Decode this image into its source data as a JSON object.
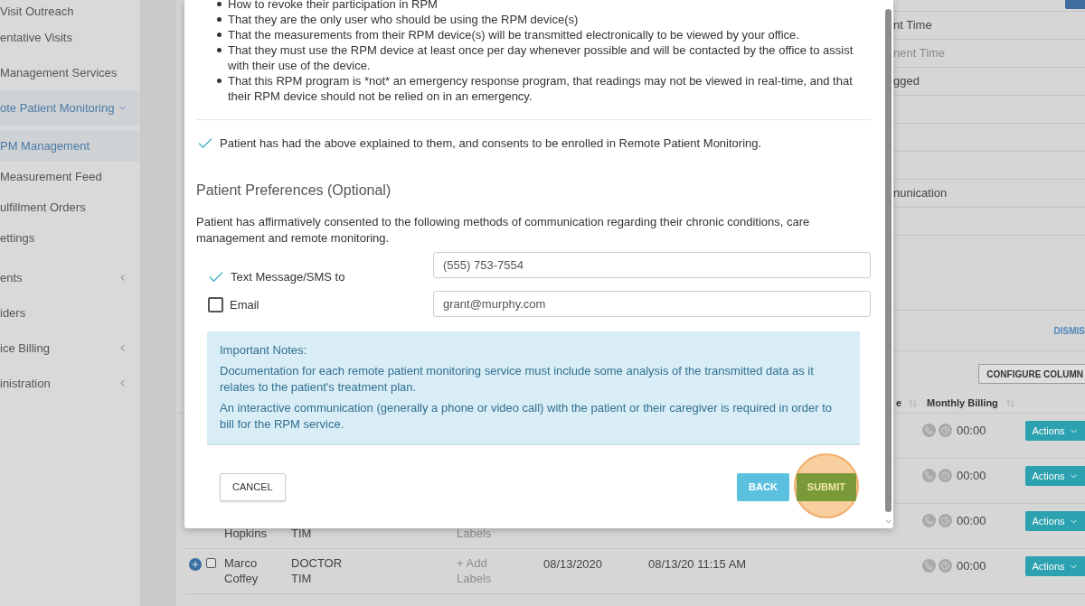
{
  "sidebar": {
    "items": [
      {
        "label": "Visit Outreach",
        "selected": false
      },
      {
        "label": "entative Visits",
        "selected": false
      },
      {
        "label": "Management Services",
        "selected": false
      },
      {
        "label": "ote Patient Monitoring",
        "selected": true,
        "expanded": true,
        "children": [
          {
            "label": "PM Management",
            "selected": true
          },
          {
            "label": "Measurement Feed",
            "selected": false
          },
          {
            "label": "ulfillment Orders",
            "selected": false
          },
          {
            "label": "ettings",
            "selected": false
          }
        ]
      },
      {
        "label": "ents",
        "selected": false,
        "expanded": false
      },
      {
        "label": "iders",
        "selected": false
      },
      {
        "label": "ice Billing",
        "selected": false,
        "expanded": false
      },
      {
        "label": "inistration",
        "selected": false,
        "expanded": false
      }
    ]
  },
  "background_form": {
    "fields": [
      {
        "kind": "value",
        "text": "nt Time"
      },
      {
        "kind": "placeholder",
        "text": "nent Time"
      },
      {
        "kind": "value",
        "text": "gged"
      },
      {
        "kind": "blank"
      },
      {
        "kind": "blank"
      },
      {
        "kind": "blank"
      },
      {
        "kind": "value",
        "text": "nunication"
      },
      {
        "kind": "blank"
      }
    ]
  },
  "dismiss_link": "DISMIS",
  "configure_button": "CONFIGURE COLUMN",
  "table": {
    "columns": [
      {
        "label": "e",
        "sortable": true
      },
      {
        "label": "Monthly Billing",
        "sortable": true
      }
    ],
    "rows": [
      {
        "billing": "00:00",
        "action": "Actions"
      },
      {
        "billing": "00:00",
        "action": "Actions"
      },
      {
        "name": "Hopkins",
        "provider": "TIM",
        "labels": "Labels",
        "billing": "00:00",
        "action": "Actions"
      },
      {
        "expandable": true,
        "checked": false,
        "name": "Marco Coffey",
        "provider": "DOCTOR TIM",
        "labels": "+ Add Labels",
        "date": "08/13/2020",
        "appointment": "08/13/20 11:15 AM",
        "billing": "00:00",
        "action": "Actions"
      }
    ]
  },
  "modal": {
    "bullets": [
      "How to revoke their participation in RPM",
      "That they are the only user who should be using the RPM device(s)",
      "That the measurements from their RPM device(s) will be transmitted electronically to be viewed by your office.",
      "That they must use the RPM device at least once per day whenever possible and will be contacted by the office to assist with their use of the device.",
      "That this RPM program is *not* an emergency response program, that readings may not be viewed in real-time, and that their RPM device should not be relied on in an emergency."
    ],
    "consent": {
      "checked": true,
      "text": "Patient has had the above explained to them, and consents to be enrolled in Remote Patient Monitoring."
    },
    "preferences_title": "Patient Preferences (Optional)",
    "preferences_text": "Patient has affirmatively consented to the following methods of communication regarding their chronic conditions, care management and remote monitoring.",
    "options": [
      {
        "label": "Text Message/SMS to",
        "checked": true,
        "value": "(555) 753-7554"
      },
      {
        "label": "Email",
        "checked": false,
        "value": "grant@murphy.com"
      }
    ],
    "notes": {
      "title": "Important Notes:",
      "paragraphs": [
        "Documentation for each remote patient monitoring service must include some analysis of the transmitted data as it relates to the patient's treatment plan.",
        "An interactive communication (generally a phone or video call) with the patient or their caregiver is required in order to bill for the RPM service."
      ]
    },
    "buttons": {
      "cancel": "CANCEL",
      "back": "BACK",
      "submit": "SUBMIT"
    }
  }
}
